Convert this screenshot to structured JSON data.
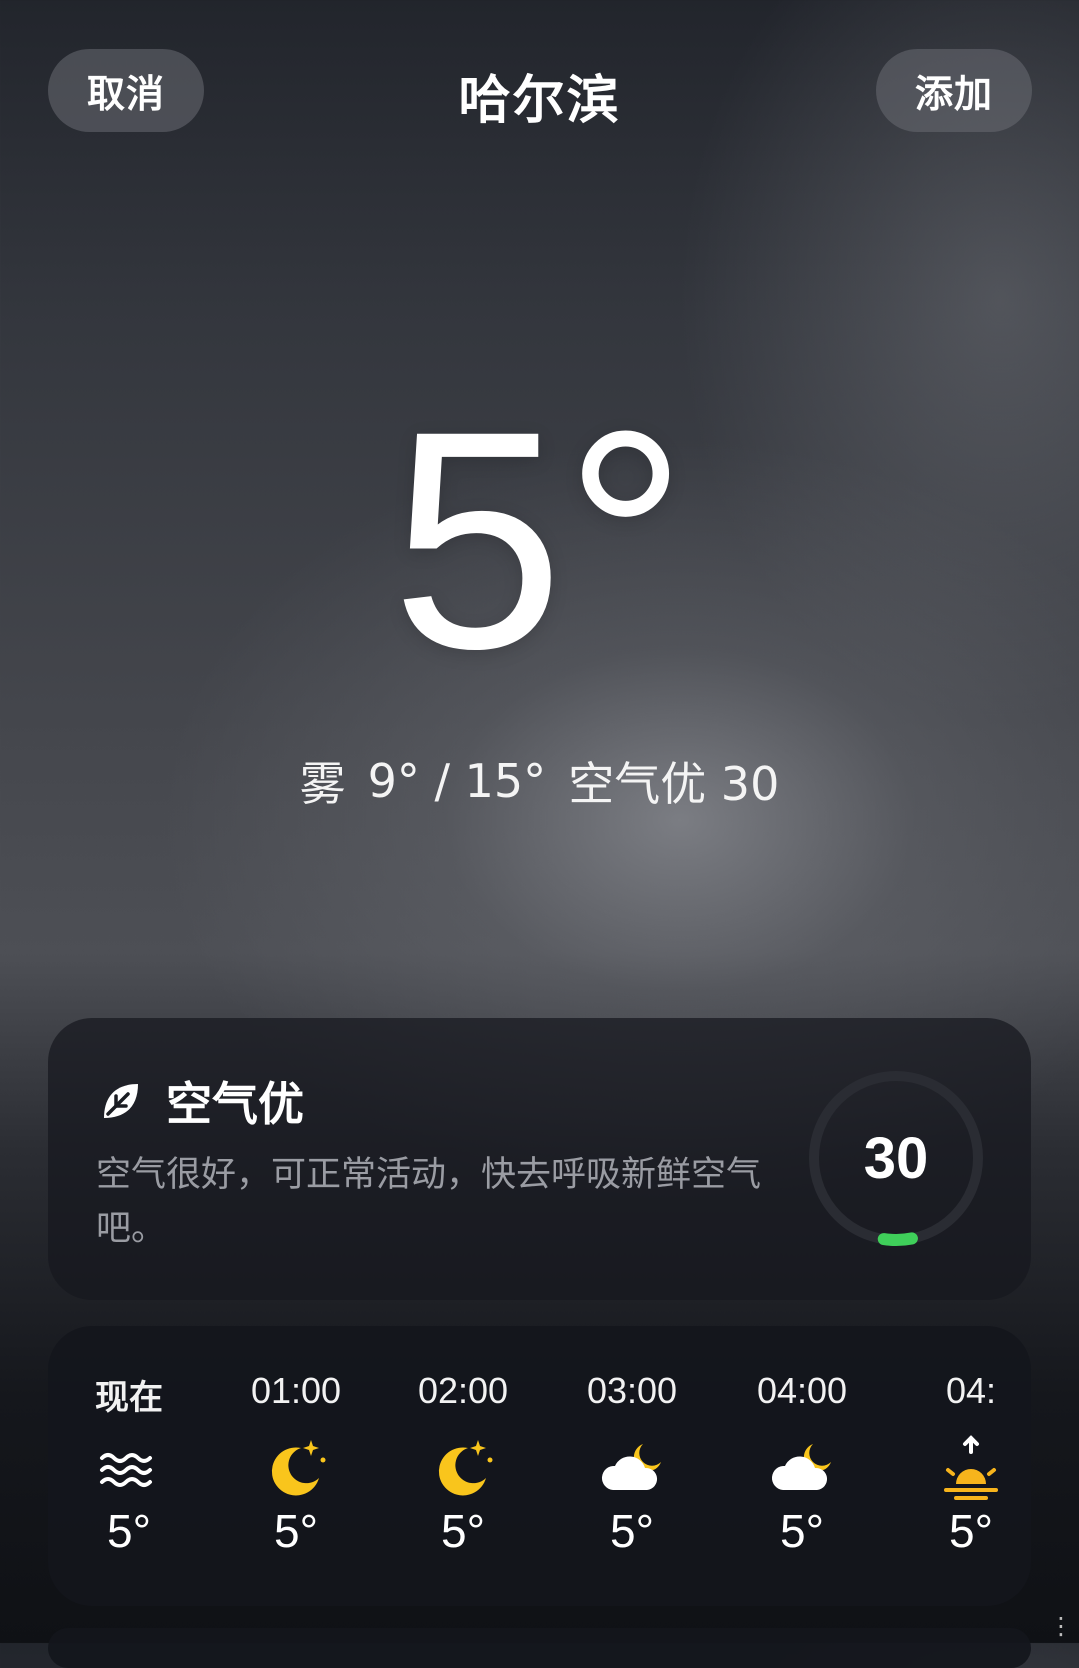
{
  "header": {
    "cancel_label": "取消",
    "city": "哈尔滨",
    "add_label": "添加"
  },
  "current": {
    "temperature": "5°",
    "condition": "雾",
    "range": "9° / 15°",
    "air_quality": "空气优 30"
  },
  "aqi_card": {
    "title": "空气优",
    "description": "空气很好，可正常活动，快去呼吸新鲜空气吧。",
    "value": "30",
    "icon": "leaf-icon",
    "level": 0.1,
    "accent_color": "#3fcf5a"
  },
  "hourly": [
    {
      "time": "现在",
      "icon": "fog-icon",
      "temp": "5°"
    },
    {
      "time": "01:00",
      "icon": "moon-stars-icon",
      "temp": "5°"
    },
    {
      "time": "02:00",
      "icon": "moon-stars-icon",
      "temp": "5°"
    },
    {
      "time": "03:00",
      "icon": "cloudy-night-icon",
      "temp": "5°"
    },
    {
      "time": "04:00",
      "icon": "cloudy-night-icon",
      "temp": "5°"
    },
    {
      "time": "04:",
      "icon": "sunrise-icon",
      "temp": "5°"
    }
  ],
  "colors": {
    "moon": "#f9c51c",
    "sun": "#f7b41c",
    "cloud": "#ffffff"
  }
}
